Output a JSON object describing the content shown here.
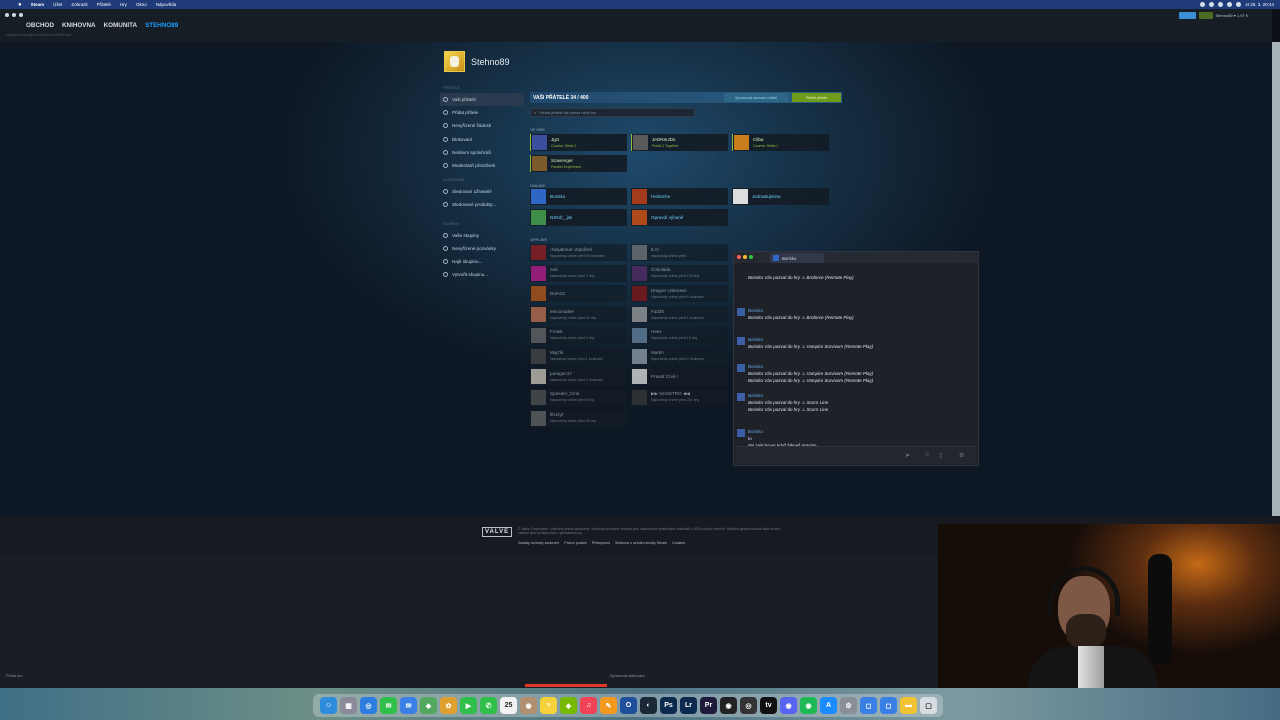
{
  "menubar": {
    "app": "Steam",
    "items": [
      "Úšet",
      "Zobrazit",
      "Přátelé",
      "Hry",
      "Okno",
      "Nápověda"
    ],
    "clock": "st 25. 3. 20:44"
  },
  "steam": {
    "nav": [
      "OBCHOD",
      "KNIHOVNA",
      "KOMUNITA",
      "STEHNO89"
    ],
    "url": "steamcommunity.com/id/stehno89/friends/",
    "account_name": "Stehno89 ▾ 1,97 €"
  },
  "profile": {
    "name": "Stehno89"
  },
  "sidebar": {
    "sections": [
      {
        "header": "PŘÁTELÉ",
        "items": [
          "Vaši přátelé",
          "Přidat přítele",
          "Nevyřízené žádosti",
          "Blokovaní",
          "Nedávní spoluhráči",
          "Moderátoři přezdívek"
        ]
      },
      {
        "header": "SLEDOVÁNÍ",
        "items": [
          "Sledovaní uživatelé",
          "Sledované produkty..."
        ]
      },
      {
        "header": "SKUPINY",
        "items": [
          "Vaše skupiny",
          "Nevyřízené pozvánky",
          "Najít skupinu...",
          "Vytvořit skupinu..."
        ]
      }
    ]
  },
  "friends": {
    "title": "VAŠI PŘÁTELÉ 34 / 400",
    "manage_label": "Spravovat seznam přátel",
    "add_label": "Přidat přítele",
    "search_placeholder": "Hledat přátele dle jména nebo hry",
    "section_ingame": "VE HŘE",
    "section_online": "ONLINE",
    "section_offline": "OFFLINE",
    "ingame": [
      {
        "name": "JgG",
        "status": "Counter-Strike 2",
        "color": "#3b4f9e"
      },
      {
        "name": "JeDNIeJDo",
        "status": "Portal 2 Together",
        "color": "#5a5a5a"
      },
      {
        "name": "Cliba",
        "status": "Counter-Strike 2",
        "color": "#c97d1c"
      },
      {
        "name": "Scavenger",
        "status": "Parallel Experiment",
        "color": "#7d5a2a"
      }
    ],
    "online": [
      {
        "name": "Borisko",
        "color": "#2f67c7"
      },
      {
        "name": "Heliotche",
        "color": "#a33b1c"
      },
      {
        "name": "Jedna8ujmina",
        "color": "#dddddd"
      },
      {
        "name": "NSNČ_.jsk",
        "color": "#3f8f4a"
      },
      {
        "name": "Opravdí výhaně",
        "color": "#b04a1a"
      }
    ],
    "offline": [
      {
        "name": "-Ninjatmus- Založení",
        "status": "Naposledy online před 65 minutami",
        "color": "#9b1b1b"
      },
      {
        "name": "ILYI",
        "status": "Naposledy online před ...",
        "color": "#777777"
      },
      {
        "name": "Ash",
        "status": "Naposledy online před 2 dny",
        "color": "#c41a8e"
      },
      {
        "name": "Čokoláda",
        "status": "Naposledy online před 124 dny",
        "color": "#5a2a6a"
      },
      {
        "name": "Dom12",
        "status": "",
        "color": "#c25a14"
      },
      {
        "name": "Dragon Unknown",
        "status": "Naposledy online před 6 hodinami",
        "color": "#8b1414"
      },
      {
        "name": "emcomaker",
        "status": "Naposledy online před 21 dny",
        "color": "#c97552"
      },
      {
        "name": "Fad3h",
        "status": "Naposledy online před 1 hodinami",
        "color": "#a5a5a5"
      },
      {
        "name": "Frosik",
        "status": "Naposledy online před 2 dny",
        "color": "#6b6b6b"
      },
      {
        "name": "Heex",
        "status": "Naposledy online před 15 dny",
        "color": "#6a8aa5"
      },
      {
        "name": "Maj7ik",
        "status": "Naposledy online před 1 hodinami",
        "color": "#4a4a4a"
      },
      {
        "name": "Martin",
        "status": "Naposledy online před 2 hodinami",
        "color": "#9aa8b4"
      },
      {
        "name": "paragon17",
        "status": "Naposledy online před 4 hodinami",
        "color": "#d8cfc2"
      },
      {
        "name": "Prasáť Cmě !",
        "status": "",
        "color": "#eeeeee"
      },
      {
        "name": "Speeder_Cink",
        "status": "Naposledy online před 9 dny",
        "color": "#555555"
      },
      {
        "name": "▶▶ NASSTRO ◀◀",
        "status": "Naposledy online před 221 dny",
        "color": "#3a3a3a"
      },
      {
        "name": "šťUkyř",
        "status": "Naposledy online před 66 dny",
        "color": "#6a6a6a"
      }
    ]
  },
  "chat": {
    "tab": "Borisko",
    "messages": [
      {
        "from": "",
        "lines": [
          "Borisko Vás pozval do hry ♨ Broforce (Remote Play)"
        ]
      },
      {
        "from": "Borisko",
        "lines": [
          "Borisko Vás pozval do hry ♨ Broforce (Remote Play)"
        ]
      },
      {
        "from": "Borisko",
        "lines": [
          "Borisko Vás pozval do hry ♨ Vampire Survivors (Remote Play)"
        ]
      },
      {
        "from": "Borisko",
        "lines": [
          "Borisko Vás pozval do hry ♨ Vampire Survivors (Remote Play)",
          "Borisko Vás pozval do hry ♨ Vampire Survivors (Remote Play)"
        ]
      },
      {
        "from": "Borisko",
        "lines": [
          "Borisko Vás pozval do hry ♨ Scorn Line",
          "Borisko Vás pozval do hry ♨ Scorn Line"
        ]
      },
      {
        "from": "Borisko",
        "lines": [
          "to",
          "dej zajit hovor když bikneš pravým",
          "zahájit"
        ]
      }
    ]
  },
  "footer": {
    "valve": "VALVE",
    "legal": "© Valve Corporation. Všechna práva vyhrazena. Všechny ochranné známky jsou vlastnictvím příslušných vlastníků v USA a jiných zemích. Některá geoprostorová data na této stránce jsou poskytována z geonames.org.",
    "links": [
      "Zásady ochrany soukromí",
      "Právní podání",
      "Přístupnost",
      "Smlouva o užívání služby Steam",
      "Cookies"
    ]
  },
  "statusbar": {
    "left": "Přidat hru",
    "center": "Spravovat stahování"
  },
  "dock": [
    {
      "icon": "finder-icon",
      "color": "#2f8bdc",
      "glyph": "☺"
    },
    {
      "icon": "launchpad-icon",
      "color": "#8a8a9a",
      "glyph": "▦"
    },
    {
      "icon": "safari-icon",
      "color": "#2d7de0",
      "glyph": "◎"
    },
    {
      "icon": "messages-icon",
      "color": "#2fbf4a",
      "glyph": "✉"
    },
    {
      "icon": "mail-icon",
      "color": "#3a7fe5",
      "glyph": "✉"
    },
    {
      "icon": "maps-icon",
      "color": "#53a85f",
      "glyph": "◆"
    },
    {
      "icon": "photos-icon",
      "color": "#e0a030",
      "glyph": "✿"
    },
    {
      "icon": "facetime-icon",
      "color": "#2fbf4a",
      "glyph": "▶"
    },
    {
      "icon": "phone-icon",
      "color": "#2fbf4a",
      "glyph": "✆"
    },
    {
      "icon": "calendar-icon",
      "color": "#f2f2f2",
      "glyph": "25"
    },
    {
      "icon": "contacts-icon",
      "color": "#b09070",
      "glyph": "◉"
    },
    {
      "icon": "notes-icon",
      "color": "#f5d23c",
      "glyph": "≡"
    },
    {
      "icon": "nvidia-icon",
      "color": "#76b900",
      "glyph": "◈"
    },
    {
      "icon": "music-icon",
      "color": "#f04356",
      "glyph": "♫"
    },
    {
      "icon": "pages-icon",
      "color": "#f39a1e",
      "glyph": "✎"
    },
    {
      "icon": "opera-icon",
      "color": "#1f4f9a",
      "glyph": "O"
    },
    {
      "icon": "steam-icon",
      "color": "#1b2838",
      "glyph": "◐"
    },
    {
      "icon": "photoshop-icon",
      "color": "#0c2a4e",
      "glyph": "Ps"
    },
    {
      "icon": "lightroom-icon",
      "color": "#0c2a4e",
      "glyph": "Lr"
    },
    {
      "icon": "premiere-icon",
      "color": "#1e1a3a",
      "glyph": "Pr"
    },
    {
      "icon": "github-icon",
      "color": "#222222",
      "glyph": "◉"
    },
    {
      "icon": "obs-icon",
      "color": "#333333",
      "glyph": "◎"
    },
    {
      "icon": "appletv-icon",
      "color": "#111111",
      "glyph": "tv"
    },
    {
      "icon": "discord-icon",
      "color": "#5865f2",
      "glyph": "◉"
    },
    {
      "icon": "spotify-icon",
      "color": "#1db954",
      "glyph": "◉"
    },
    {
      "icon": "appstore-icon",
      "color": "#1a8cff",
      "glyph": "A"
    },
    {
      "icon": "settings-icon",
      "color": "#8a8f96",
      "glyph": "⚙"
    },
    {
      "icon": "preview-icon",
      "color": "#3a7fe5",
      "glyph": "◻"
    },
    {
      "icon": "screenshot-icon",
      "color": "#3a7fe5",
      "glyph": "◻"
    },
    {
      "icon": "folder-icon",
      "color": "#f1c232",
      "glyph": "▬"
    },
    {
      "icon": "trash-icon",
      "color": "#d8dde2",
      "glyph": "▢"
    }
  ]
}
